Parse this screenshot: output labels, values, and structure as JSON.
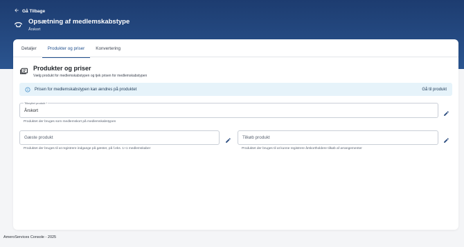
{
  "header": {
    "back_label": "Gå Tilbage",
    "title": "Opsætning af medlemskabstype",
    "subtitle": "Årskort"
  },
  "tabs": [
    {
      "label": "Detaljer",
      "active": false
    },
    {
      "label": "Produkter og priser",
      "active": true
    },
    {
      "label": "Konvertering",
      "active": false
    }
  ],
  "section": {
    "title": "Produkter og priser",
    "subtitle": "Vælg produkt for medlemskabstypen og tjek prisen for medlemskabstypen"
  },
  "info": {
    "text": "Prisen for medlemskabstypen kan ændres på produktet",
    "link": "Gå til produkt"
  },
  "fields": {
    "linked_product": {
      "label": "Tilknyttet produkt *",
      "value": "Årskort",
      "help": "Produktet der bruges som medlemskort på medlemskabstypen"
    },
    "guest_product": {
      "placeholder": "Gæste produkt",
      "help": "Produktet der bruges til at registrere indgange på gæster, på f.eks. 1+1 medlemskaber"
    },
    "addon_product": {
      "placeholder": "Tilkøb produkt",
      "help": "Produktet der bruges til at kunne registrere årskortholdere tilkøb af arrangementer"
    }
  },
  "footer": {
    "text": "AmeroServices Console - 2025"
  },
  "colors": {
    "header_bg": "#1d3c70",
    "accent": "#1f4e8c",
    "info_bg": "#e6f3fa"
  }
}
